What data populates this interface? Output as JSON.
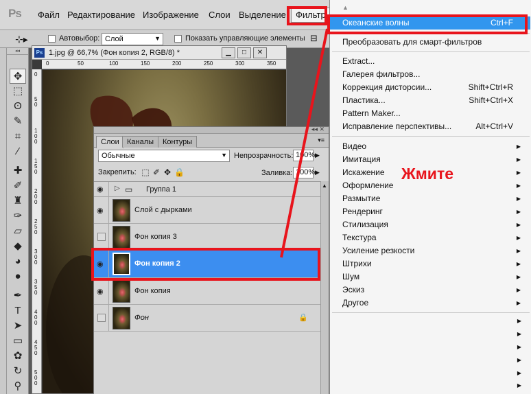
{
  "app": {
    "logo": "Ps",
    "menus": [
      "Файл",
      "Редактирование",
      "Изображение",
      "Слои",
      "Выделение",
      "Фильтр"
    ]
  },
  "options_bar": {
    "autoselect_label": "Автовыбор:",
    "autoselect_value": "Слой",
    "show_controls_label": "Показать управляющие элементы"
  },
  "document": {
    "icon": "Ps",
    "title": "1.jpg @ 66,7% (Фон копия 2, RGB/8) *",
    "ruler_h": [
      "0",
      "50",
      "100",
      "150",
      "200",
      "250",
      "300",
      "350"
    ],
    "ruler_v": [
      "0",
      "5 0",
      "1 0 0",
      "1 5 0",
      "2 0 0",
      "2 5 0",
      "3 0 0",
      "3 5 0",
      "4 0 0",
      "4 5 0",
      "5 0 0"
    ]
  },
  "layers_panel": {
    "tabs": [
      "Слои",
      "Каналы",
      "Контуры"
    ],
    "blend_mode": "Обычные",
    "opacity_label": "Непрозрачность:",
    "opacity_value": "100%",
    "lock_label": "Закрепить:",
    "fill_label": "Заливка:",
    "fill_value": "100%",
    "layers": [
      {
        "name": "Группа 1",
        "type": "group",
        "visible": true
      },
      {
        "name": "Слой с дырками",
        "type": "layer",
        "visible": true
      },
      {
        "name": "Фон копия 3",
        "type": "layer",
        "visible": false
      },
      {
        "name": "Фон копия 2",
        "type": "layer",
        "visible": true,
        "selected": true
      },
      {
        "name": "Фон копия",
        "type": "layer",
        "visible": true
      },
      {
        "name": "Фон",
        "type": "layer",
        "visible": false,
        "locked": true
      }
    ]
  },
  "filter_menu": {
    "last_filter": {
      "label": "Океанские волны",
      "shortcut": "Ctrl+F"
    },
    "smart": "Преобразовать для смарт-фильтров",
    "tools": [
      {
        "label": "Extract...",
        "shortcut": ""
      },
      {
        "label": "Галерея фильтров...",
        "shortcut": ""
      },
      {
        "label": "Коррекция дисторсии...",
        "shortcut": "Shift+Ctrl+R"
      },
      {
        "label": "Пластика...",
        "shortcut": "Shift+Ctrl+X"
      },
      {
        "label": "Pattern Maker...",
        "shortcut": ""
      },
      {
        "label": "Исправление перспективы...",
        "shortcut": "Alt+Ctrl+V"
      }
    ],
    "groups": [
      "Видео",
      "Имитация",
      "Искажение",
      "Оформление",
      "Размытие",
      "Рендеринг",
      "Стилизация",
      "Текстура",
      "Усиление резкости",
      "Штрихи",
      "Шум",
      "Эскиз",
      "Другое"
    ]
  },
  "annotation": {
    "text": "Жмите",
    "color": "#e8141c"
  },
  "colors": {
    "highlight": "#3296ee",
    "selected_layer": "#3c8ef0"
  }
}
